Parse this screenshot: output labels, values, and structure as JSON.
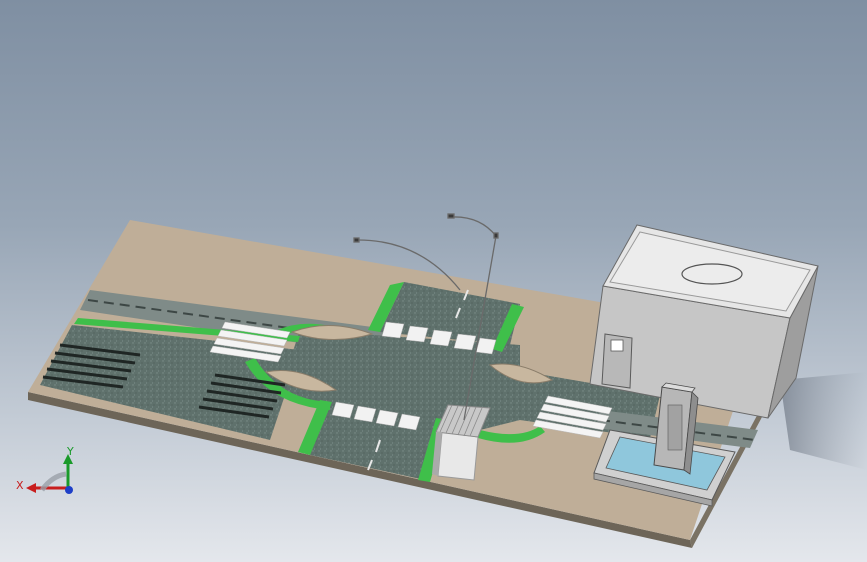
{
  "viewport": {
    "background_top": "#7f8fa2",
    "background_bottom": "#e4e7ec"
  },
  "scene": {
    "sidewalk_color": "#bfae98",
    "road_color": "#5f716c",
    "grass_color": "#3fbf4a",
    "stripe_color": "#f4f4f4",
    "building_color": "#c9c9c9",
    "pool_water_color": "#8fc7dc"
  },
  "triad": {
    "x_label": "X",
    "y_label": "Y",
    "x_color": "#c81e1e",
    "y_color": "#1a9a2a",
    "z_color": "#1e3fc8",
    "icons": [
      "x-axis-arrow-icon",
      "y-axis-arrow-icon",
      "z-axis-dot-icon"
    ]
  }
}
